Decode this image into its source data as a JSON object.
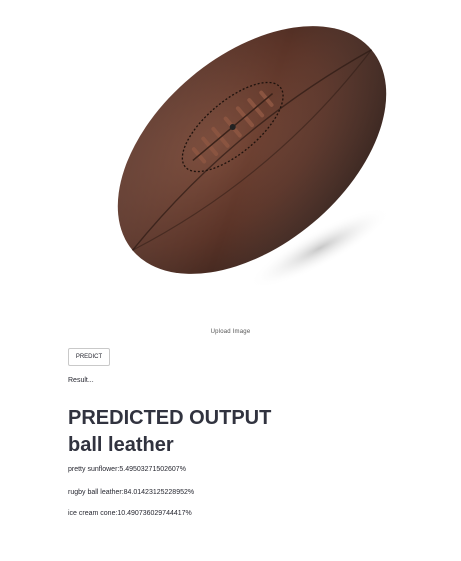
{
  "image": {
    "subject_icon": "rugby-ball-leather-photo",
    "caption": "Upload Image"
  },
  "controls": {
    "predict_label": "PREDICT",
    "result_text": "Result..."
  },
  "output": {
    "heading": "PREDICTED OUTPUT",
    "predicted_label": "ball leather",
    "probabilities": [
      "pretty sunflower:5.49503271502607%",
      "rugby ball leather:84.01423125228952%",
      "ice cream cone:10.490736029744417%"
    ]
  },
  "colors": {
    "leather_dark": "#4a2c22",
    "leather_mid": "#6b4032",
    "text": "#262730"
  }
}
